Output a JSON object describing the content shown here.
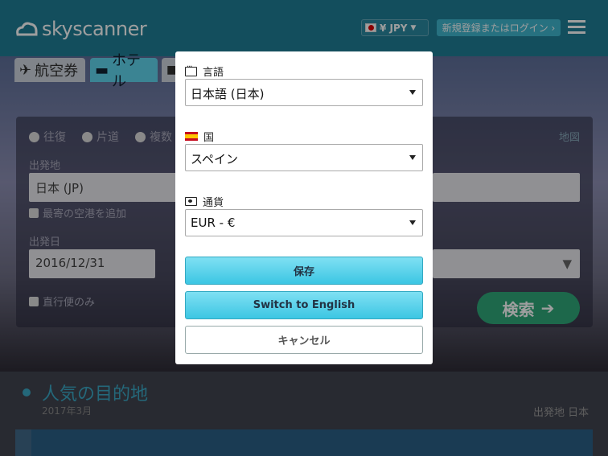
{
  "header": {
    "brand": "skyscanner",
    "currency_button": "¥ JPY",
    "login_button": "新規登録またはログイン ›"
  },
  "tabs": {
    "flights": "航空券",
    "hotels": "ホテル"
  },
  "search": {
    "trip_types": [
      "往復",
      "片道",
      "複数"
    ],
    "map_link": "地図",
    "origin_label": "出発地",
    "origin_value": "日本 (JP)",
    "nearby_airports": "最寄の空港を追加",
    "depart_label": "出発日",
    "depart_value": "2016/12/31",
    "direct_only": "直行便のみ",
    "search_button": "検索"
  },
  "popular": {
    "title": "人気の目的地",
    "date": "2017年3月",
    "origin": "出発地 日本"
  },
  "modal": {
    "language_label": "言語",
    "language_value": "日本語 (日本)",
    "country_label": "国",
    "country_value": "スペイン",
    "currency_label": "通貨",
    "currency_value": "EUR - €",
    "save_button": "保存",
    "switch_button": "Switch to English",
    "cancel_button": "キャンセル"
  },
  "colors": {
    "accent": "#3cc6e3",
    "brand": "#1f7f97",
    "search_green": "#2fa87a"
  }
}
